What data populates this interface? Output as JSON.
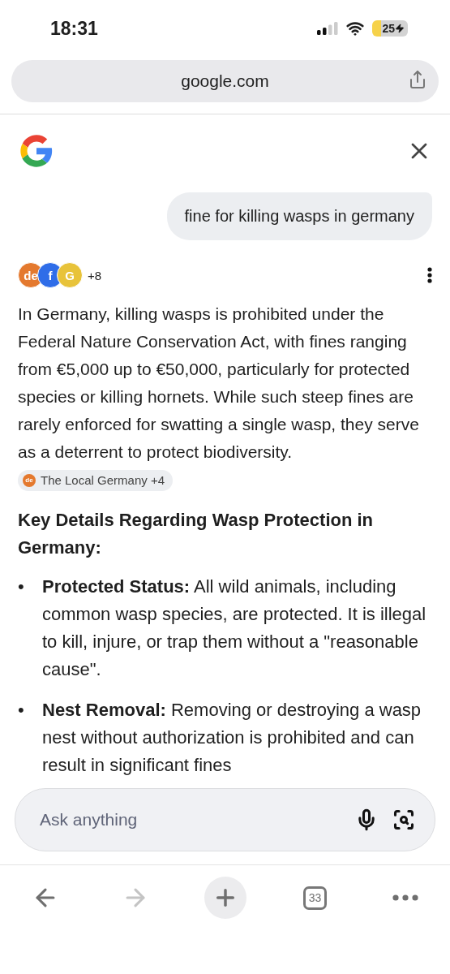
{
  "status_bar": {
    "time": "18:31",
    "battery": "25"
  },
  "address_bar": {
    "url": "google.com"
  },
  "query": "fine for killing wasps in germany",
  "sources": {
    "badges": [
      {
        "label": "de",
        "color": "#e4792e"
      },
      {
        "label": "f",
        "color": "#2f6de8"
      },
      {
        "label": "G",
        "color": "#e8c33a"
      }
    ],
    "more": "+8"
  },
  "answer": {
    "paragraph": "In Germany, killing wasps is prohibited under the Federal Nature Conservation Act, with fines ranging from €5,000 up to €50,000, particularly for protected species or killing hornets. While such steep fines are rarely enforced for swatting a single wasp, they serve as a deterrent to protect biodiversity.",
    "citation": {
      "badge": "de",
      "label": "The Local Germany +4"
    },
    "heading": "Key Details Regarding Wasp Protection in Germany:",
    "bullets": [
      {
        "marker": "•",
        "text": "**Protected Status:** All wild animals, including common wasp species, are protected. It is illegal to kill, injure, or trap them without a \"reasonable cause\"."
      },
      {
        "marker": "•",
        "text": "**Nest Removal:** Removing or destroying a wasp nest without authorization is prohibited and can result in significant fines"
      }
    ]
  },
  "ask": {
    "placeholder": "Ask anything"
  },
  "toolbar": [
    {
      "kind": "back",
      "disabled": false
    },
    {
      "kind": "forward",
      "disabled": true
    },
    {
      "kind": "new-tab",
      "disabled": false
    },
    {
      "kind": "tabs",
      "label": "33",
      "disabled": false
    },
    {
      "kind": "more",
      "disabled": false
    }
  ]
}
